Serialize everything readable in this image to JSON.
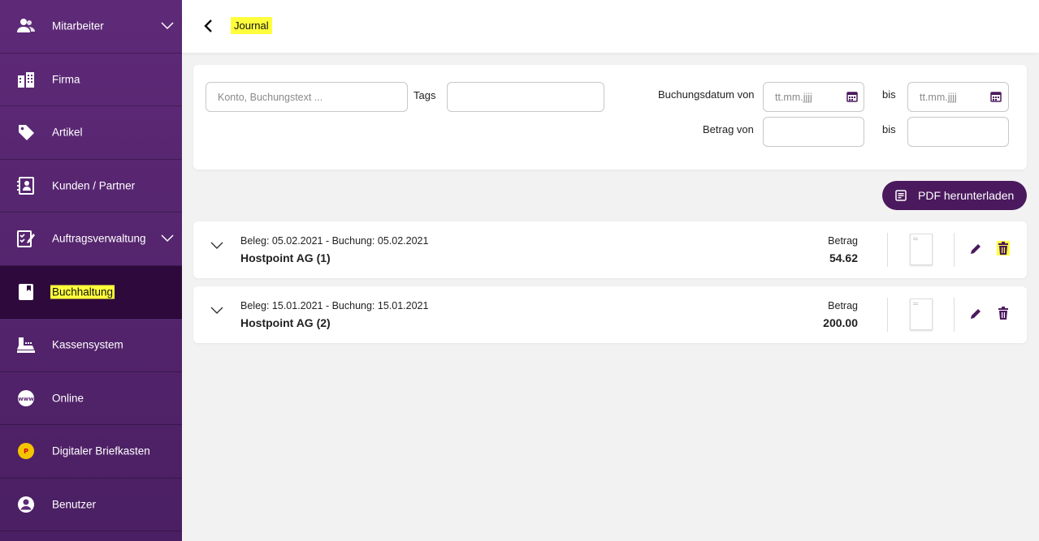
{
  "sidebar": {
    "items": [
      {
        "label": "Mitarbeiter",
        "icon": "users-icon",
        "expandable": true
      },
      {
        "label": "Firma",
        "icon": "building-icon",
        "expandable": false
      },
      {
        "label": "Artikel",
        "icon": "tag-icon",
        "expandable": false
      },
      {
        "label": "Kunden / Partner",
        "icon": "contacts-book-icon",
        "expandable": false
      },
      {
        "label": "Auftragsverwaltung",
        "icon": "checklist-icon",
        "expandable": true
      },
      {
        "label": "Buchhaltung",
        "icon": "ledger-book-icon",
        "expandable": false,
        "active": true
      },
      {
        "label": "Kassensystem",
        "icon": "cash-register-icon",
        "expandable": false
      },
      {
        "label": "Online",
        "icon": "www-globe-icon",
        "expandable": false
      },
      {
        "label": "Digitaler Briefkasten",
        "icon": "post-logo-icon",
        "expandable": false
      },
      {
        "label": "Benutzer",
        "icon": "user-circle-icon",
        "expandable": false
      }
    ]
  },
  "header": {
    "title": "Journal"
  },
  "filters": {
    "search_placeholder": "Konto, Buchungstext ...",
    "tags_label": "Tags",
    "tags_value": "",
    "date_from_label": "Buchungsdatum von",
    "date_placeholder": "tt.mm.jjjj",
    "to_label": "bis",
    "amount_from_label": "Betrag von",
    "amount_from_value": "",
    "amount_to_value": ""
  },
  "actions": {
    "pdf_label": "PDF herunterladen"
  },
  "entries": [
    {
      "dates": "Beleg: 05.02.2021 - Buchung: 05.02.2021",
      "name": "Hostpoint AG (1)",
      "amount_label": "Betrag",
      "amount": "54.62"
    },
    {
      "dates": "Beleg: 15.01.2021 - Buchung: 15.01.2021",
      "name": "Hostpoint AG (2)",
      "amount_label": "Betrag",
      "amount": "200.00"
    }
  ],
  "colors": {
    "sidebar": "#5e2a78",
    "sidebar_active": "#2e0a3c",
    "accent": "#4b1a5e",
    "highlight": "#ffff3c"
  }
}
